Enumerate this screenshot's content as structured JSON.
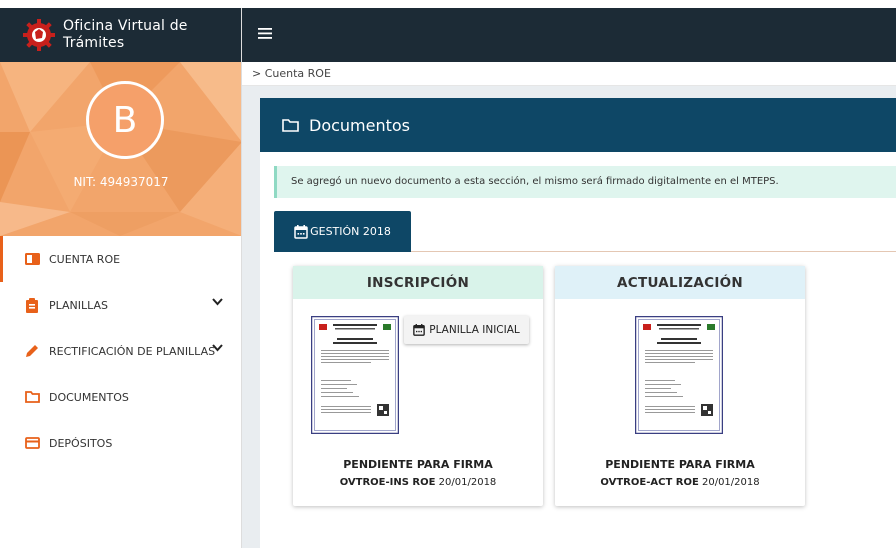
{
  "app": {
    "title_line1": "Oficina Virtual de",
    "title_line2": "Trámites"
  },
  "profile": {
    "initial": "B",
    "nit": "NIT: 494937017"
  },
  "sidebar": {
    "items": [
      {
        "label": "CUENTA ROE",
        "icon": "account-card-icon",
        "active": true
      },
      {
        "label": "PLANILLAS",
        "icon": "clipboard-icon",
        "expandable": true
      },
      {
        "label": "RECTIFICACIÓN DE PLANILLAS",
        "icon": "pencil-icon",
        "expandable": true
      },
      {
        "label": "DOCUMENTOS",
        "icon": "folder-icon"
      },
      {
        "label": "DEPÓSITOS",
        "icon": "credit-card-icon"
      }
    ]
  },
  "breadcrumb": "> Cuenta ROE",
  "panel": {
    "title": "Documentos"
  },
  "alert": "Se agregó un nuevo documento a esta sección, el mismo será firmado digitalmente en el MTEPS.",
  "tab": {
    "label": "GESTIÓN 2018"
  },
  "cards": [
    {
      "title": "INSCRIPCIÓN",
      "button": "PLANILLA INICIAL",
      "status": "PENDIENTE PARA FIRMA",
      "code": "OVTROE-INS ROE",
      "date": "20/01/2018",
      "head_color": "#d9f3ea"
    },
    {
      "title": "ACTUALIZACIÓN",
      "status": "PENDIENTE PARA FIRMA",
      "code": "OVTROE-ACT ROE",
      "date": "20/01/2018",
      "head_color": "#dff1f8"
    }
  ],
  "colors": {
    "topbar": "#1c2b36",
    "accent": "#e8611a",
    "panel_header": "#0e4766",
    "profile_bg": "#f2a56b"
  }
}
